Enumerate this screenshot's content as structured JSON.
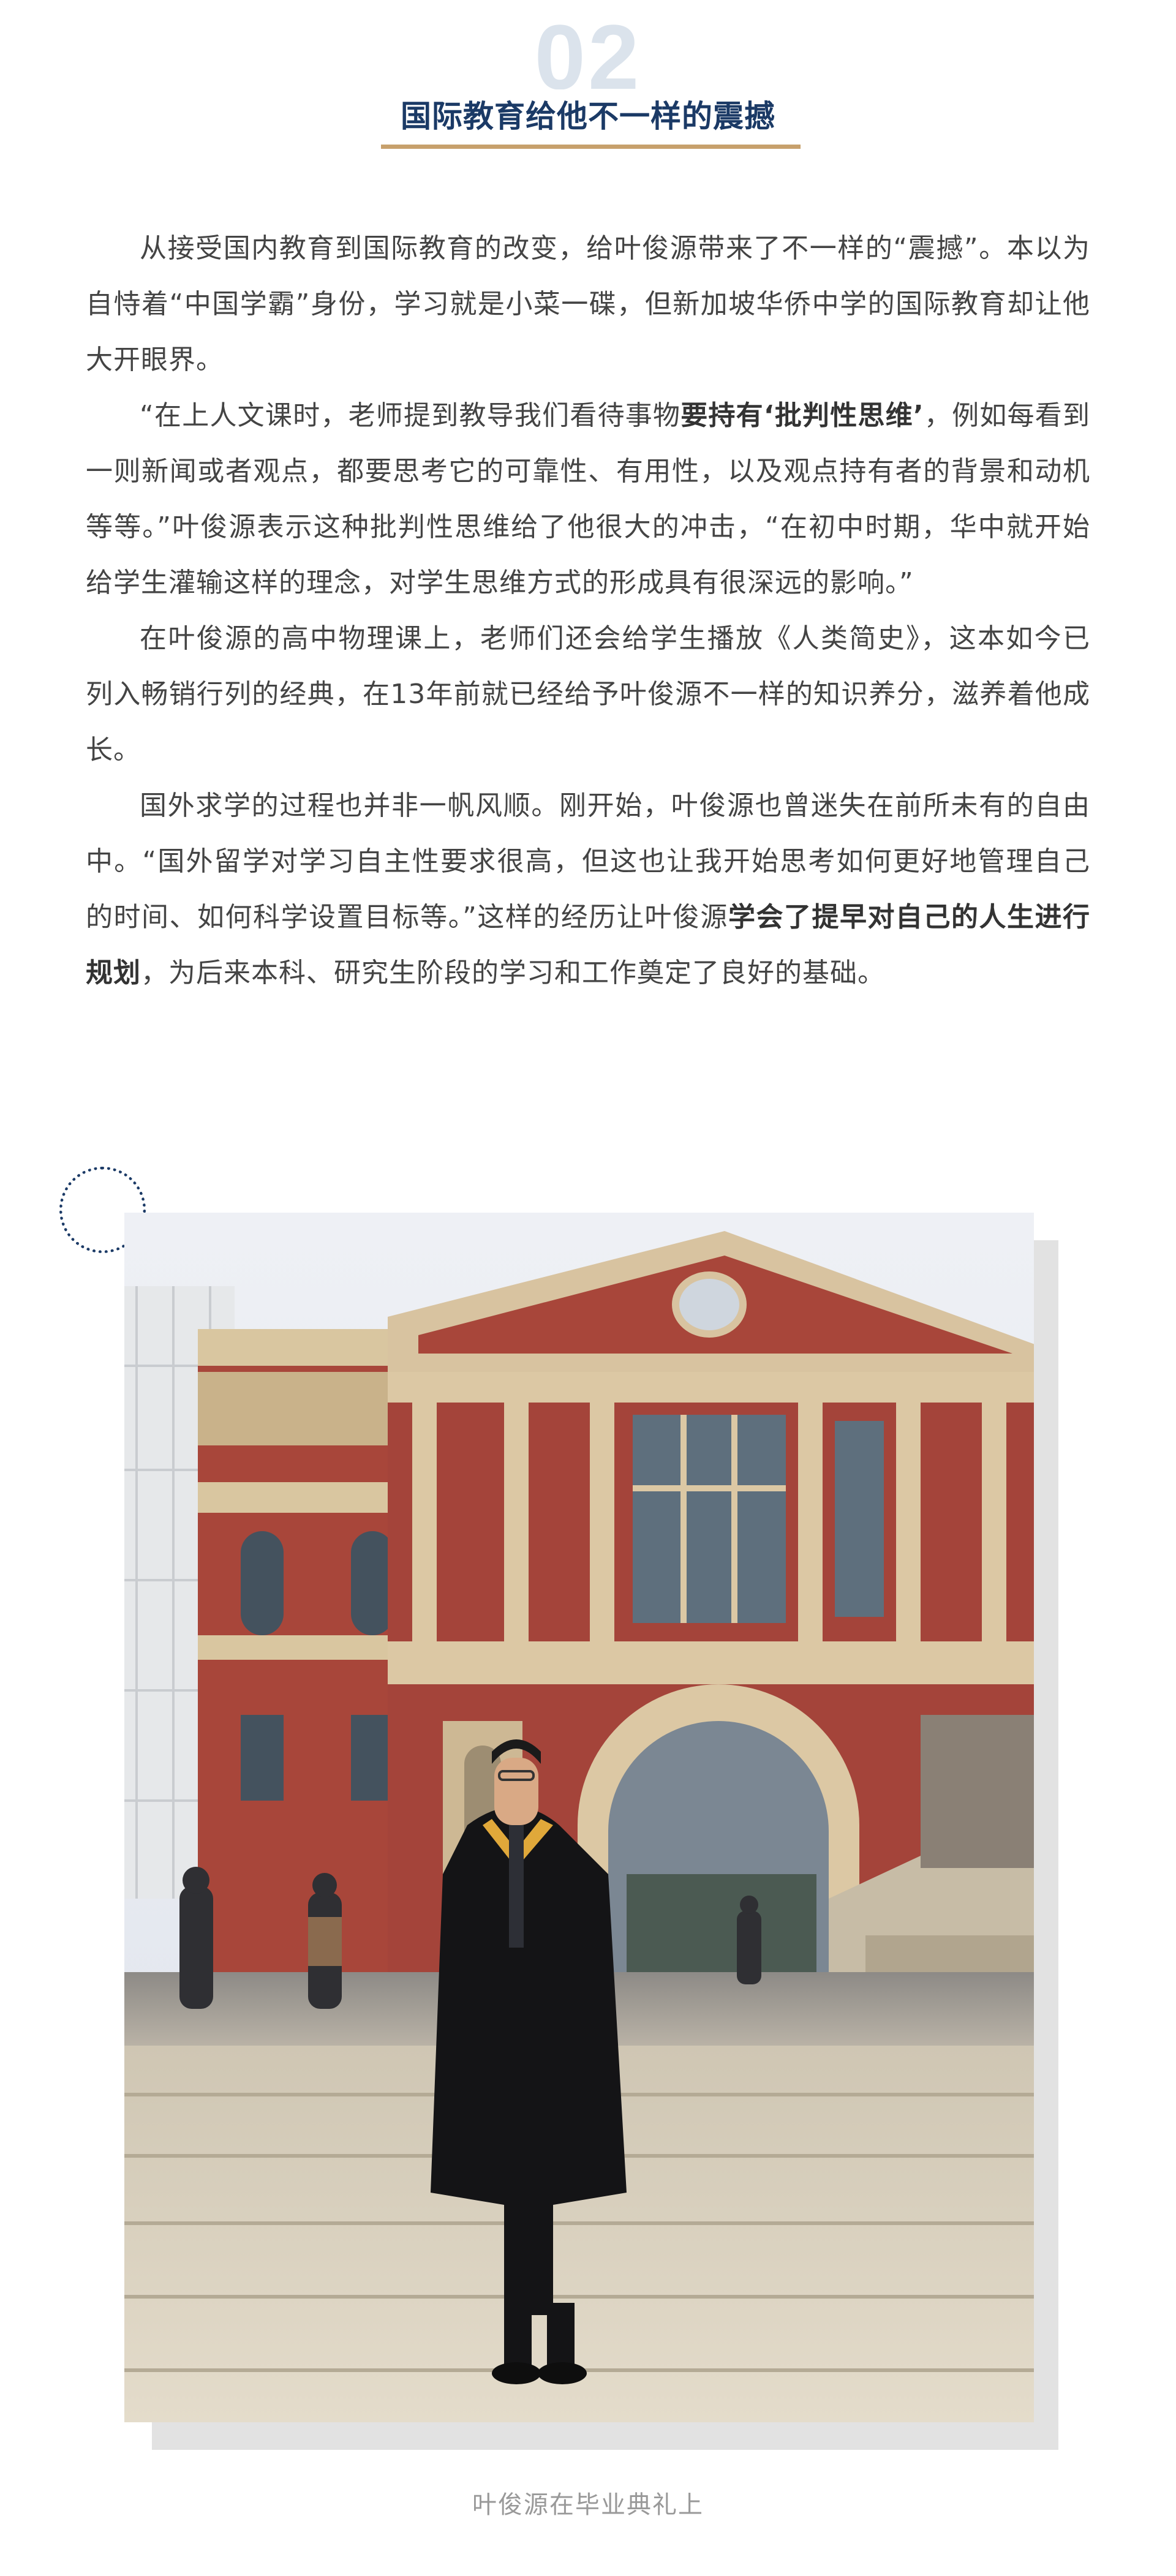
{
  "section": {
    "number": "02",
    "title": "国际教育给他不一样的震撼"
  },
  "article": {
    "p1": "从接受国内教育到国际教育的改变，给叶俊源带来了不一样的“震撼”。本以为自恃着“中国学霸”身份，学习就是小菜一碟，但新加坡华侨中学的国际教育却让他大开眼界。",
    "p2_a": "“在上人文课时，老师提到教导我们看待事物",
    "p2_bold": "要持有‘批判性思维’",
    "p2_b": "，例如每看到一则新闻或者观点，都要思考它的可靠性、有用性，以及观点持有者的背景和动机等等。”叶俊源表示这种批判性思维给了他很大的冲击，“在初中时期，华中就开始给学生灌输这样的理念，对学生思维方式的形成具有很深远的影响。”",
    "p3": "在叶俊源的高中物理课上，老师们还会给学生播放《人类简史》，这本如今已列入畅销行列的经典，在13年前就已经给予叶俊源不一样的知识养分，滋养着他成长。",
    "p4_a": "国外求学的过程也并非一帆风顺。刚开始，叶俊源也曾迷失在前所未有的自由中。“国外留学对学习自主性要求很高，但这也让我开始思考如何更好地管理自己的时间、如何科学设置目标等。”这样的经历让叶俊源",
    "p4_bold": "学会了提早对自己的人生进行规划",
    "p4_b": "，为后来本科、研究生阶段的学习和工作奠定了良好的基础。"
  },
  "photo": {
    "caption": "叶俊源在毕业典礼上"
  },
  "colors": {
    "title": "#1b3a66",
    "number": "#dbe3ec",
    "underline": "#c7a06c",
    "body_text": "#444444",
    "caption": "#999999"
  }
}
